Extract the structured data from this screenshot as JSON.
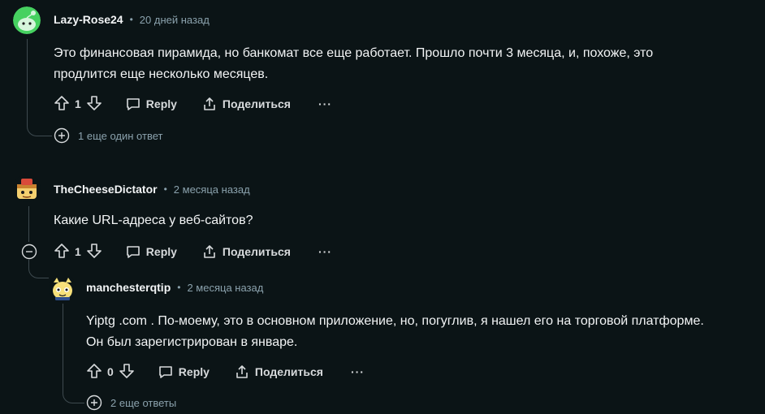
{
  "comments": [
    {
      "author": "Lazy-Rose24",
      "time": "20 дней назад",
      "text_line1": "Это финансовая пирамида, но банкомат все еще работает. Прошло почти 3 месяца, и, похоже, это",
      "text_line2": "продлится еще несколько месяцев.",
      "score": "1",
      "reply_label": "Reply",
      "share_label": "Поделиться",
      "more_replies": "1 еще один ответ"
    },
    {
      "author": "TheCheeseDictator",
      "time": "2 месяца назад",
      "text_line1": "Какие URL-адреса у веб-сайтов?",
      "score": "1",
      "reply_label": "Reply",
      "share_label": "Поделиться"
    },
    {
      "author": "manchesterqtip",
      "time": "2 месяца назад",
      "text_line1": "Yiptg .com . По-моему, это в основном приложение, но, погуглив, я нашел его на торговой платформе.",
      "text_line2": "Он был зарегистрирован в январе.",
      "score": "0",
      "reply_label": "Reply",
      "share_label": "Поделиться",
      "more_replies": "2 еще ответы"
    }
  ],
  "separator": "•",
  "overflow_label": "···"
}
